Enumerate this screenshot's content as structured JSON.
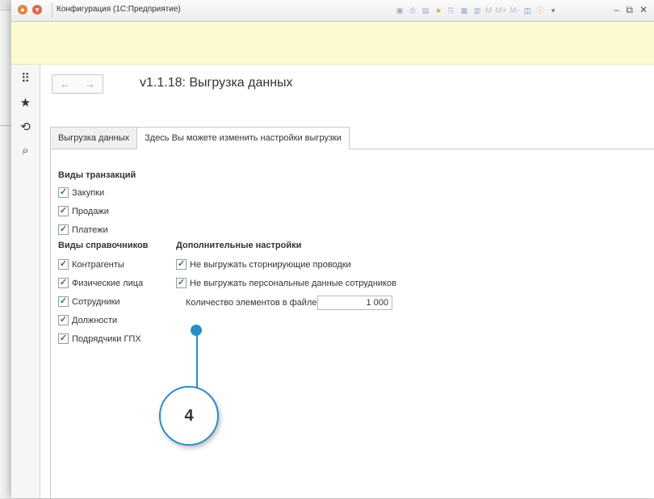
{
  "window": {
    "title": "Конфигурация  (1С:Предприятие)",
    "toolbar_text_m": "M",
    "toolbar_text_mplus": "M+",
    "toolbar_text_mminus": "M-"
  },
  "nav": {
    "back": "←",
    "forward": "→"
  },
  "form": {
    "title": "v1.1.18: Выгрузка данных"
  },
  "tabs": [
    {
      "label": "Выгрузка данных",
      "active": false
    },
    {
      "label": "Здесь Вы можете изменить настройки выгрузки",
      "active": true
    }
  ],
  "transactions": {
    "title": "Виды транзакций",
    "items": [
      {
        "label": "Закупки",
        "checked": true
      },
      {
        "label": "Продажи",
        "checked": true
      },
      {
        "label": "Платежи",
        "checked": true
      }
    ]
  },
  "catalogs": {
    "title": "Виды справочников",
    "items": [
      {
        "label": "Контрагенты",
        "checked": true
      },
      {
        "label": "Физические лица",
        "checked": true
      },
      {
        "label": "Сотрудники",
        "checked": true
      },
      {
        "label": "Должности",
        "checked": true
      },
      {
        "label": "Подрядчики ГПХ",
        "checked": true
      }
    ]
  },
  "extra": {
    "title": "Дополнительные настройки",
    "items": [
      {
        "label": "Не выгружать сторнирующие проводки",
        "checked": true
      },
      {
        "label": "Не выгружать персональные данные сотрудников",
        "checked": true
      }
    ],
    "qty_label": "Количество элементов в файле:",
    "qty_value": "1 000"
  },
  "callout": {
    "number": "4"
  },
  "colors": {
    "accent": "#2a8fc7",
    "infobar": "#fbfbcf",
    "check": "#1f8a1f"
  },
  "icons": [
    "apps-grid-icon",
    "star-icon",
    "history-icon",
    "search-icon"
  ]
}
